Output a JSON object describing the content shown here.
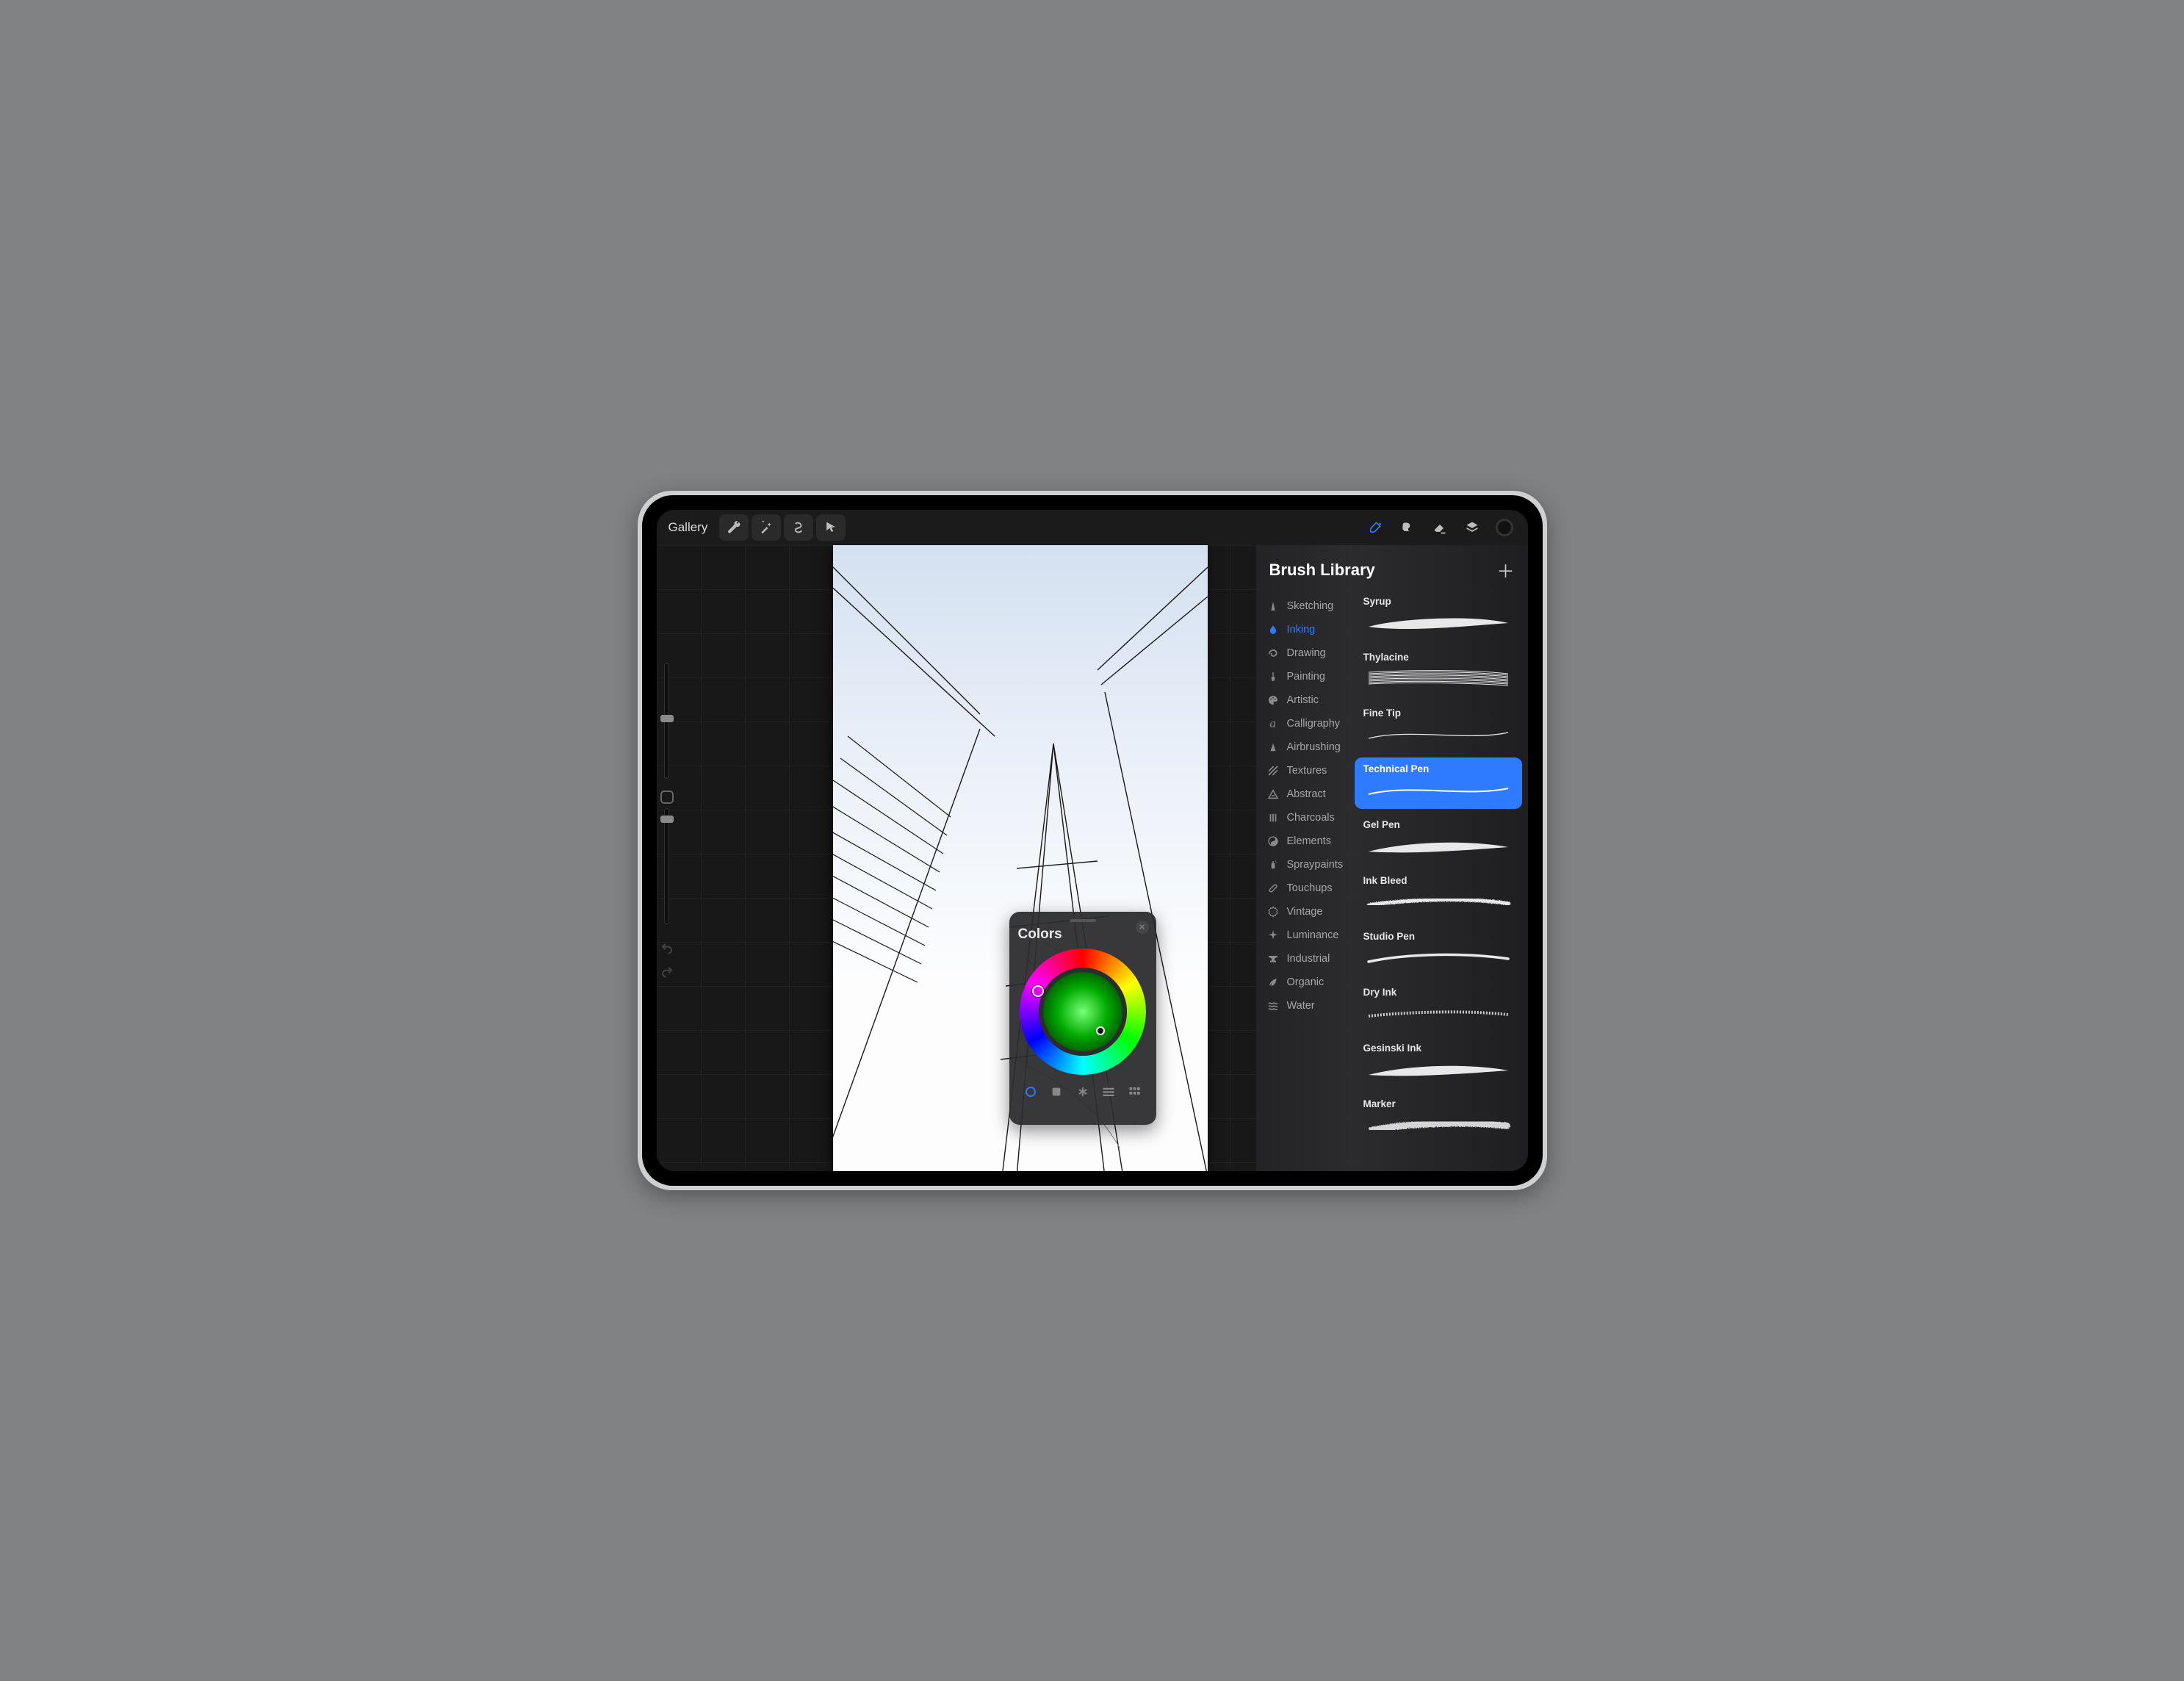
{
  "topbar": {
    "gallery_label": "Gallery",
    "accent_color": "#2f7bff"
  },
  "left_rail": {
    "slider1_pos": 0.45,
    "slider2_pos": 0.06
  },
  "colors_panel": {
    "title": "Colors",
    "hue_angle": 95,
    "tabs": [
      "disc",
      "classic",
      "harmony",
      "value",
      "palette"
    ],
    "active_tab": "disc"
  },
  "brush_library": {
    "title": "Brush Library",
    "categories": [
      {
        "name": "Sketching",
        "icon": "pencil"
      },
      {
        "name": "Inking",
        "icon": "drop",
        "active": true
      },
      {
        "name": "Drawing",
        "icon": "swirl"
      },
      {
        "name": "Painting",
        "icon": "paintbrush"
      },
      {
        "name": "Artistic",
        "icon": "palette"
      },
      {
        "name": "Calligraphy",
        "icon": "script-a"
      },
      {
        "name": "Airbrushing",
        "icon": "spray-cone"
      },
      {
        "name": "Textures",
        "icon": "diag-hatch"
      },
      {
        "name": "Abstract",
        "icon": "triangle-a"
      },
      {
        "name": "Charcoals",
        "icon": "bars"
      },
      {
        "name": "Elements",
        "icon": "yinyang"
      },
      {
        "name": "Spraypaints",
        "icon": "spray-can"
      },
      {
        "name": "Touchups",
        "icon": "bandage"
      },
      {
        "name": "Vintage",
        "icon": "gear"
      },
      {
        "name": "Luminance",
        "icon": "sparkle"
      },
      {
        "name": "Industrial",
        "icon": "anvil"
      },
      {
        "name": "Organic",
        "icon": "leaf"
      },
      {
        "name": "Water",
        "icon": "waves"
      }
    ],
    "brushes": [
      {
        "name": "Syrup",
        "style": "taper"
      },
      {
        "name": "Thylacine",
        "style": "scratch"
      },
      {
        "name": "Fine Tip",
        "style": "thin"
      },
      {
        "name": "Technical Pen",
        "style": "thin",
        "selected": true
      },
      {
        "name": "Gel Pen",
        "style": "gel"
      },
      {
        "name": "Ink Bleed",
        "style": "rough"
      },
      {
        "name": "Studio Pen",
        "style": "med"
      },
      {
        "name": "Dry Ink",
        "style": "dry"
      },
      {
        "name": "Gesinski Ink",
        "style": "gel"
      },
      {
        "name": "Marker",
        "style": "marker"
      }
    ]
  }
}
